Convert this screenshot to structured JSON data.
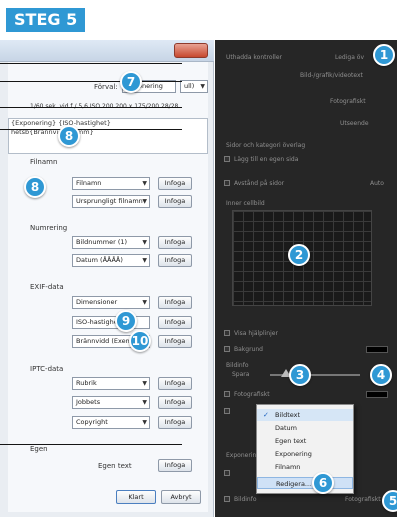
{
  "heading": "STEG 5",
  "dialog": {
    "preset_label": "Förval:",
    "preset_value": "Exponering [7]...",
    "preset_value_short": "Exponering",
    "preset_value_end": "ull)",
    "summary": "1/60 sek. vid f / 5,6 ISO 200 200 x 175/200 28/28",
    "preview_line1": "{Exponering} {ISO-hastighet}",
    "preview_line2": "hetsb{Brännvidd} {mm}",
    "sections": {
      "filename": "Filnamn",
      "numbering": "Numrering",
      "exif": "EXIF-data",
      "iptc": "IPTC-data",
      "own": "Egen"
    },
    "filename_rows": [
      {
        "value": "Filnamn",
        "button": "Infoga"
      },
      {
        "value": "Ursprungligt filnamn",
        "button": "Infoga"
      }
    ],
    "numbering_rows": [
      {
        "value": "Bildnummer (1)",
        "button": "Infoga"
      },
      {
        "value": "Datum (ÅÅÅÅ)",
        "button": "Infoga"
      }
    ],
    "exif_rows": [
      {
        "value": "Dimensioner",
        "button": "Infoga"
      },
      {
        "value": "ISO-hastighet",
        "button": "Infoga"
      },
      {
        "value": "Brännvidd (Exem.)",
        "button": "Infoga"
      }
    ],
    "iptc_rows": [
      {
        "value": "Rubrik",
        "button": "Infoga"
      },
      {
        "value": "Jobbets",
        "button": "Infoga"
      },
      {
        "value": "Copyright",
        "button": "Infoga"
      }
    ],
    "own_text_label": "Egen text",
    "own_text_button": "Infoga",
    "done_button": "Klart",
    "cancel_button": "Avbryt"
  },
  "panel": {
    "row1": "Uthadda kontroller",
    "row1_right": "Lediga öv",
    "row2": "Bild-/grafik/videotext",
    "row3": "Fotografiskt",
    "row4": "Utseende",
    "row5": "Sidor och kategori överlag",
    "row6": "Lägg till en egen sida",
    "row7": "Avstånd på sidor",
    "row7_right": "Auto",
    "row8": "Inner cellbild",
    "row9": "Visa hjälplinjer",
    "row10": "Bakgrund",
    "row11": "Bildinfo",
    "row12": "Spara",
    "row13": "Fotografiskt",
    "row14": "Exponering",
    "row15": "Bildinfo",
    "row15_right": "Fotografiskt"
  },
  "menu": {
    "items": [
      "Bildtext",
      "Datum",
      "Egen text",
      "Exponering",
      "Filnamn",
      "Redigera..."
    ],
    "checked_index": 0,
    "highlighted_index": 5
  },
  "badges": [
    "1",
    "2",
    "3",
    "4",
    "5",
    "6",
    "7",
    "8",
    "8",
    "9",
    "10"
  ],
  "colors": {
    "accent": "#2f98d4",
    "panel_bg": "#262626",
    "dialog_bg": "#e9edf2"
  }
}
